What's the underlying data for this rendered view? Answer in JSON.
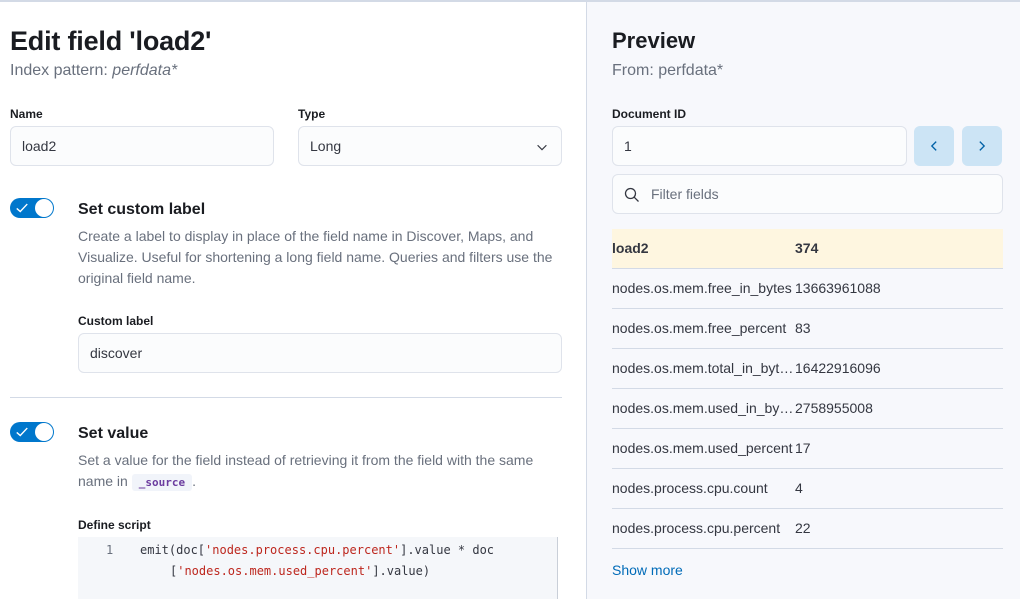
{
  "editor": {
    "title": "Edit field 'load2'",
    "subtitle_prefix": "Index pattern: ",
    "subtitle_pattern": "perfdata*",
    "name_label": "Name",
    "name_value": "load2",
    "type_label": "Type",
    "type_value": "Long",
    "custom_label_section": {
      "title": "Set custom label",
      "description": "Create a label to display in place of the field name in Discover, Maps, and Visualize. Useful for shortening a long field name. Queries and filters use the original field name.",
      "enabled": true,
      "field_label": "Custom label",
      "field_value": "discover"
    },
    "value_section": {
      "title": "Set value",
      "description_prefix": "Set a value for the field instead of retrieving it from the field with the same name in ",
      "description_code": "_source",
      "description_suffix": ".",
      "enabled": true,
      "script_label": "Define script",
      "line_number": "1",
      "script_line1_a": "emit(doc[",
      "script_line1_str": "'nodes.process.cpu.percent'",
      "script_line1_b": "].value * doc",
      "script_line2_a": "[",
      "script_line2_str": "'nodes.os.mem.used_percent'",
      "script_line2_b": "].value)"
    }
  },
  "preview": {
    "title": "Preview",
    "from": "From: perfdata*",
    "doc_id_label": "Document ID",
    "doc_id_value": "1",
    "prev_icon": "chevron-left-icon",
    "next_icon": "chevron-right-icon",
    "filter_placeholder": "Filter fields",
    "fields": [
      {
        "name": "load2",
        "value": "374",
        "highlight": true
      },
      {
        "name": "nodes.os.mem.free_in_bytes",
        "value": "13663961088"
      },
      {
        "name": "nodes.os.mem.free_percent",
        "value": "83"
      },
      {
        "name": "nodes.os.mem.total_in_bytes",
        "value": "16422916096"
      },
      {
        "name": "nodes.os.mem.used_in_bytes",
        "value": "2758955008"
      },
      {
        "name": "nodes.os.mem.used_percent",
        "value": "17"
      },
      {
        "name": "nodes.process.cpu.count",
        "value": "4"
      },
      {
        "name": "nodes.process.cpu.percent",
        "value": "22"
      }
    ],
    "show_more": "Show more"
  },
  "colors": {
    "accent": "#0077cc",
    "highlight_row": "#fef6e0",
    "link": "#006bb8"
  }
}
